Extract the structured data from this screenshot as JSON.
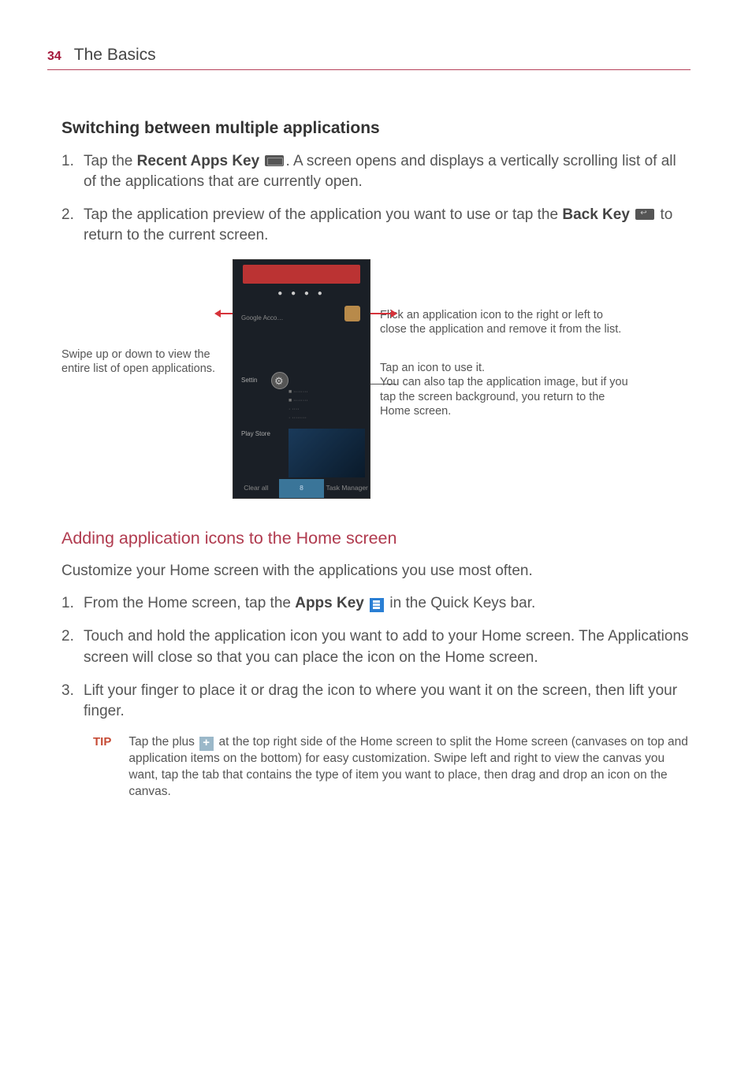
{
  "header": {
    "page_number": "34",
    "chapter": "The Basics"
  },
  "section1": {
    "heading": "Switching between multiple applications",
    "step1_pre": "Tap the ",
    "step1_bold": "Recent Apps Key ",
    "step1_post": ". A screen opens and displays a vertically scrolling list of all of the applications that are currently open.",
    "step2_pre": "Tap the application preview of the application you want to use or tap the ",
    "step2_bold": "Back Key ",
    "step2_post": " to return to the current screen."
  },
  "figure": {
    "left_caption": "Swipe up or down to view the entire list of open applications.",
    "right_cap1": "Flick an application icon to the right or left to close the application and remove it from the list.",
    "right_cap2a": "Tap an icon to use it.",
    "right_cap2b": "You can also tap the application image, but if you tap the screen background, you return to the Home screen.",
    "screenshot": {
      "app1": "Google Acco…",
      "app2": "Settin",
      "app3": "Play Store",
      "dots": "● ● ● ●",
      "btn_left": "Clear all",
      "btn_center": "8",
      "btn_right": "Task Manager"
    }
  },
  "section2": {
    "heading": "Adding application icons to the Home screen",
    "intro": "Customize your Home screen with the applications you use most often.",
    "step1_pre": "From the Home screen, tap the ",
    "step1_bold": "Apps Key ",
    "step1_post": " in the Quick Keys bar.",
    "step2": "Touch and hold the application icon you want to add to your Home screen. The Applications screen will close so that you can place the icon on the Home screen.",
    "step3": "Lift your finger to place it or drag the icon to where you want it on the screen, then lift your finger."
  },
  "tip": {
    "label": "TIP",
    "text_pre": "Tap the plus ",
    "text_post": " at the top right side of the Home screen to split the Home screen (canvases on top and application items on the bottom) for easy customization. Swipe left and right to view the canvas you want, tap the tab that contains the type of item you want to place, then drag and drop an icon on the canvas."
  }
}
